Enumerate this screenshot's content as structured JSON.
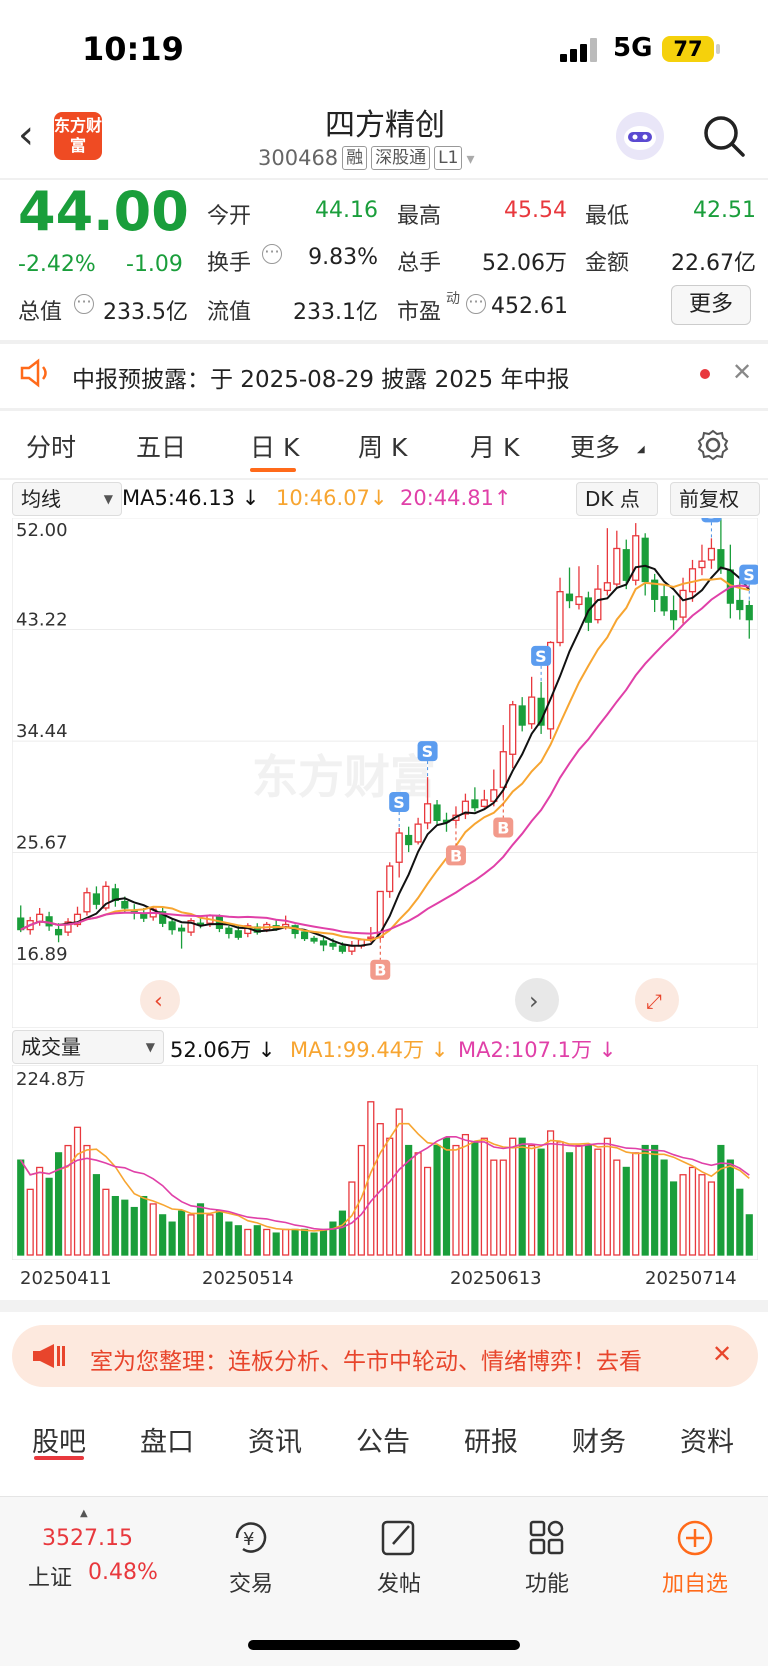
{
  "status": {
    "time": "10:19",
    "network": "5G",
    "battery": "77"
  },
  "header": {
    "logo_text": "东方财富",
    "name": "四方精创",
    "code": "300468",
    "tags": [
      "融",
      "深股通",
      "L1"
    ]
  },
  "quote": {
    "price": "44.00",
    "change_pct": "-2.42%",
    "change": "-1.09",
    "open_label": "今开",
    "open": "44.16",
    "high_label": "最高",
    "high": "45.54",
    "low_label": "最低",
    "low": "42.51",
    "turnover_label": "换手",
    "turnover": "9.83%",
    "vol_label": "总手",
    "vol": "52.06万",
    "amount_label": "金额",
    "amount": "22.67亿",
    "mcap_label": "总值",
    "mcap": "233.5亿",
    "float_label": "流值",
    "float_cap": "233.1亿",
    "pe_label": "市盈",
    "pe_sup": "动",
    "pe": "452.61",
    "more": "更多"
  },
  "notice": {
    "text": "中报预披露：于 2025-08-29 披露 2025 年中报"
  },
  "period_tabs": [
    "分时",
    "五日",
    "日 K",
    "周 K",
    "月 K",
    "更多"
  ],
  "chart_header": {
    "indicator": "均线",
    "ma5": "MA5:46.13",
    "ma10": "10:46.07",
    "ma20": "20:44.81",
    "dk": "DK 点",
    "adjust": "前复权"
  },
  "colors": {
    "up": "#e8383d",
    "down": "#1a9e3b",
    "ma5": "#111111",
    "ma10": "#f7a531",
    "ma20": "#e040a8",
    "accent": "#ff6a1a"
  },
  "chart_data": {
    "type": "candlestick",
    "ylim": [
      16.89,
      52.0
    ],
    "y_ticks": [
      "52.00",
      "43.22",
      "34.44",
      "25.67",
      "16.89"
    ],
    "x_ticks": [
      "20250411",
      "20250514",
      "20250613",
      "20250714"
    ],
    "watermark": "东方财富",
    "candles": [
      [
        20.5,
        19.6,
        21.5,
        19.4
      ],
      [
        19.6,
        20.3,
        20.6,
        19.2
      ],
      [
        20.2,
        20.8,
        21.3,
        19.9
      ],
      [
        20.6,
        19.9,
        21.0,
        19.5
      ],
      [
        19.6,
        19.2,
        20.1,
        18.6
      ],
      [
        19.4,
        20.2,
        20.5,
        19.1
      ],
      [
        20.0,
        20.8,
        21.4,
        19.8
      ],
      [
        21.0,
        22.5,
        22.9,
        20.7
      ],
      [
        22.4,
        21.6,
        23.0,
        21.2
      ],
      [
        21.3,
        23.0,
        23.4,
        21.1
      ],
      [
        22.8,
        21.9,
        23.2,
        21.4
      ],
      [
        21.8,
        21.3,
        22.2,
        20.9
      ],
      [
        21.1,
        20.9,
        21.6,
        20.4
      ],
      [
        20.8,
        20.5,
        21.3,
        20.2
      ],
      [
        20.6,
        21.2,
        21.4,
        20.3
      ],
      [
        21.0,
        20.1,
        21.3,
        19.8
      ],
      [
        20.2,
        19.6,
        20.4,
        19.2
      ],
      [
        19.7,
        19.5,
        20.0,
        18.1
      ],
      [
        19.4,
        20.3,
        20.5,
        19.1
      ],
      [
        20.1,
        20.0,
        20.5,
        19.7
      ],
      [
        20.1,
        20.7,
        20.8,
        19.8
      ],
      [
        20.6,
        19.7,
        20.8,
        19.4
      ],
      [
        19.7,
        19.3,
        19.9,
        18.9
      ],
      [
        19.5,
        19.0,
        20.0,
        18.8
      ],
      [
        19.3,
        19.9,
        20.1,
        19.0
      ],
      [
        19.8,
        19.4,
        20.1,
        19.2
      ],
      [
        19.6,
        20.0,
        20.2,
        19.4
      ],
      [
        19.9,
        19.7,
        20.4,
        19.5
      ],
      [
        19.8,
        20.0,
        20.7,
        19.6
      ],
      [
        19.9,
        19.3,
        20.0,
        18.9
      ],
      [
        19.4,
        18.9,
        19.6,
        18.7
      ],
      [
        18.9,
        18.7,
        19.1,
        18.5
      ],
      [
        18.7,
        18.4,
        19.0,
        17.9
      ],
      [
        18.5,
        18.3,
        18.9,
        18.0
      ],
      [
        18.3,
        17.9,
        18.6,
        17.7
      ],
      [
        17.9,
        18.3,
        18.7,
        17.6
      ],
      [
        18.3,
        18.8,
        18.9,
        18.1
      ],
      [
        18.9,
        19.0,
        19.8,
        18.6
      ],
      [
        19.0,
        22.6,
        22.6,
        18.8
      ],
      [
        22.6,
        24.6,
        24.9,
        22.1
      ],
      [
        24.9,
        27.2,
        27.6,
        23.7
      ],
      [
        27.0,
        26.3,
        27.7,
        25.7
      ],
      [
        26.5,
        27.9,
        28.4,
        26.3
      ],
      [
        28.0,
        29.5,
        31.6,
        27.5
      ],
      [
        29.4,
        28.2,
        29.8,
        27.9
      ],
      [
        28.2,
        28.1,
        28.8,
        27.3
      ],
      [
        28.2,
        28.6,
        29.3,
        27.8
      ],
      [
        28.7,
        29.7,
        30.3,
        28.3
      ],
      [
        29.8,
        29.2,
        30.8,
        28.9
      ],
      [
        29.3,
        29.8,
        30.6,
        29.2
      ],
      [
        29.7,
        30.6,
        32.2,
        29.3
      ],
      [
        30.8,
        33.6,
        35.7,
        30.0
      ],
      [
        33.4,
        37.3,
        37.6,
        32.3
      ],
      [
        37.2,
        35.7,
        37.9,
        35.2
      ],
      [
        35.8,
        37.9,
        39.5,
        35.4
      ],
      [
        37.8,
        35.7,
        39.1,
        35.0
      ],
      [
        35.4,
        42.2,
        42.3,
        34.6
      ],
      [
        42.2,
        46.2,
        47.3,
        41.9
      ],
      [
        46.0,
        45.5,
        48.1,
        44.9
      ],
      [
        45.2,
        45.8,
        48.2,
        44.8
      ],
      [
        45.7,
        43.8,
        46.2,
        43.1
      ],
      [
        44.0,
        46.4,
        48.3,
        43.7
      ],
      [
        46.3,
        46.9,
        51.2,
        45.9
      ],
      [
        46.8,
        49.6,
        51.0,
        46.6
      ],
      [
        49.5,
        47.1,
        50.3,
        46.4
      ],
      [
        47.1,
        50.6,
        51.6,
        46.7
      ],
      [
        50.4,
        47.0,
        50.8,
        45.9
      ],
      [
        47.1,
        45.6,
        47.6,
        44.6
      ],
      [
        45.8,
        44.7,
        46.8,
        44.3
      ],
      [
        44.7,
        44.0,
        45.9,
        43.2
      ],
      [
        44.2,
        46.3,
        47.3,
        43.7
      ],
      [
        46.2,
        48.0,
        48.7,
        45.4
      ],
      [
        48.1,
        48.6,
        49.9,
        47.5
      ],
      [
        48.7,
        49.6,
        50.4,
        48.0
      ],
      [
        49.5,
        48.0,
        52.1,
        47.6
      ],
      [
        47.9,
        45.3,
        49.9,
        44.1
      ],
      [
        45.5,
        44.8,
        47.1,
        44.0
      ],
      [
        45.1,
        44.0,
        45.5,
        42.5
      ]
    ],
    "buy_sell_markers": [
      "S",
      "S",
      "S",
      "S",
      "B",
      "B",
      "B",
      "S"
    ],
    "volume": {
      "title": "成交量",
      "value": "52.06万",
      "ma1": "MA1:99.44万",
      "ma2": "MA2:107.1万",
      "max_label": "224.8万",
      "ylim": [
        0,
        224.8
      ],
      "bars": [
        130,
        90,
        120,
        105,
        140,
        150,
        175,
        150,
        110,
        90,
        80,
        75,
        65,
        80,
        70,
        55,
        45,
        60,
        55,
        70,
        55,
        60,
        45,
        40,
        35,
        40,
        35,
        30,
        35,
        35,
        35,
        30,
        35,
        45,
        60,
        100,
        150,
        210,
        180,
        160,
        200,
        150,
        140,
        120,
        150,
        160,
        150,
        165,
        155,
        160,
        130,
        130,
        160,
        160,
        150,
        145,
        170,
        155,
        140,
        150,
        150,
        145,
        160,
        130,
        120,
        140,
        150,
        150,
        130,
        100,
        110,
        120,
        110,
        100,
        150,
        130,
        90,
        55
      ]
    }
  },
  "canvas_overlays": [
    "left-arrow",
    "right-arrow",
    "expand"
  ],
  "promo": {
    "text": "室为您整理：连板分析、牛市中轮动、情绪博弈！去看"
  },
  "bottom_tabs": [
    "股吧",
    "盘口",
    "资讯",
    "公告",
    "研报",
    "财务",
    "资料"
  ],
  "footer": {
    "index_value": "3527.15",
    "index_name": "上证",
    "index_change": "0.48%",
    "items": [
      "交易",
      "发帖",
      "功能",
      "加自选"
    ]
  }
}
